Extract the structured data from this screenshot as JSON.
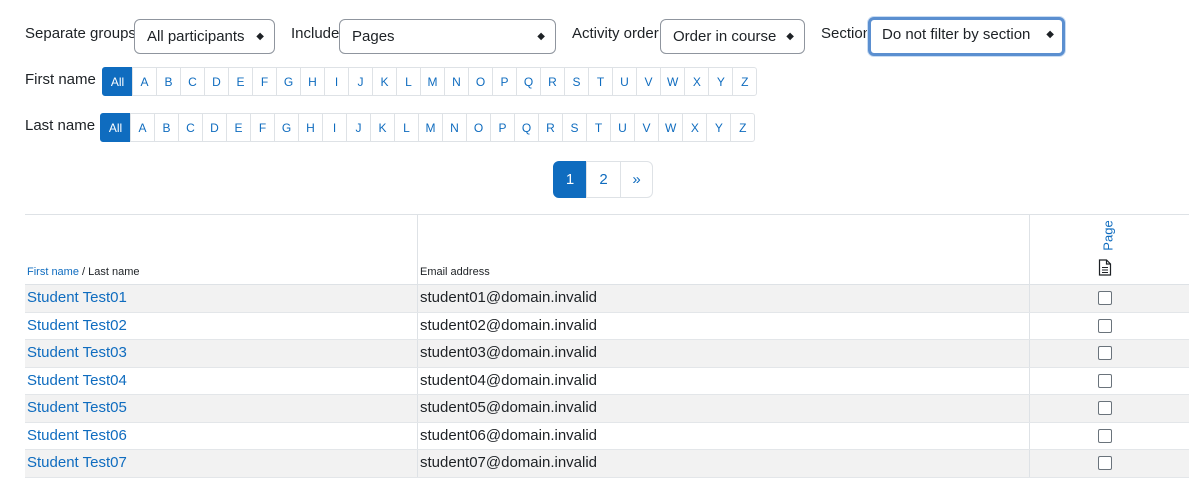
{
  "filters": {
    "groups": {
      "label": "Separate groups",
      "value": "All participants"
    },
    "include": {
      "label": "Include",
      "value": "Pages"
    },
    "order": {
      "label": "Activity order",
      "value": "Order in course"
    },
    "section": {
      "label": "Section",
      "value": "Do not filter by section"
    }
  },
  "first_name_filter": {
    "label": "First name",
    "letters": [
      "All",
      "A",
      "B",
      "C",
      "D",
      "E",
      "F",
      "G",
      "H",
      "I",
      "J",
      "K",
      "L",
      "M",
      "N",
      "O",
      "P",
      "Q",
      "R",
      "S",
      "T",
      "U",
      "V",
      "W",
      "X",
      "Y",
      "Z"
    ]
  },
  "last_name_filter": {
    "label": "Last name",
    "letters": [
      "All",
      "A",
      "B",
      "C",
      "D",
      "E",
      "F",
      "G",
      "H",
      "I",
      "J",
      "K",
      "L",
      "M",
      "N",
      "O",
      "P",
      "Q",
      "R",
      "S",
      "T",
      "U",
      "V",
      "W",
      "X",
      "Y",
      "Z"
    ]
  },
  "pagination": {
    "pages": [
      "1",
      "2"
    ],
    "next": "»",
    "current": "1"
  },
  "table": {
    "header": {
      "first_name": "First name",
      "separator": " / ",
      "last_name": "Last name",
      "email": "Email address",
      "activity": "Page"
    },
    "rows": [
      {
        "name": "Student Test01",
        "email": "student01@domain.invalid"
      },
      {
        "name": "Student Test02",
        "email": "student02@domain.invalid"
      },
      {
        "name": "Student Test03",
        "email": "student03@domain.invalid"
      },
      {
        "name": "Student Test04",
        "email": "student04@domain.invalid"
      },
      {
        "name": "Student Test05",
        "email": "student05@domain.invalid"
      },
      {
        "name": "Student Test06",
        "email": "student06@domain.invalid"
      },
      {
        "name": "Student Test07",
        "email": "student07@domain.invalid"
      }
    ]
  },
  "colors": {
    "link": "#0f6cbf",
    "active": "#0f6cbf",
    "focus": "#5b8fd0",
    "row_stripe": "#f2f2f2"
  }
}
